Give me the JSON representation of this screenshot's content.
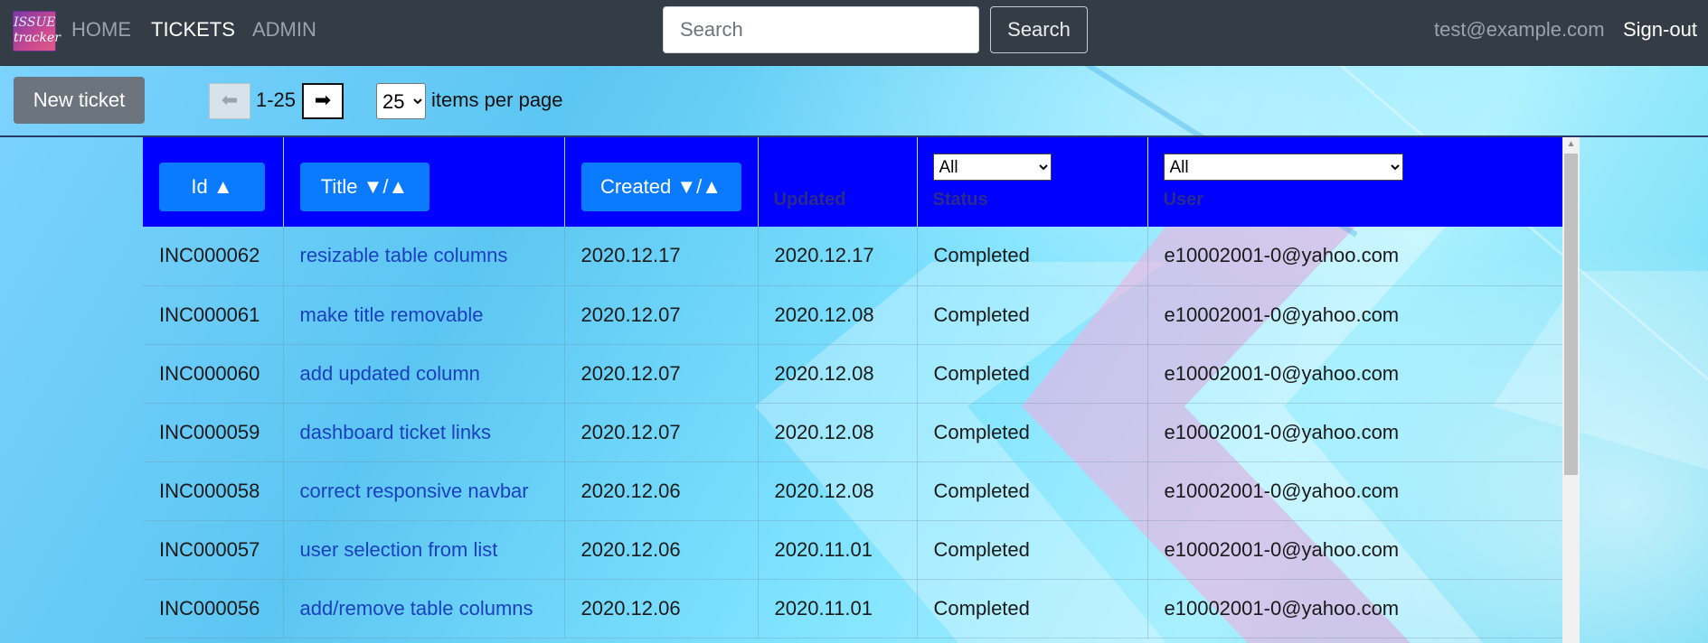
{
  "nav": {
    "logo_line1": "ISSUE",
    "logo_line2": "tracker",
    "links": [
      "HOME",
      "TICKETS",
      "ADMIN"
    ],
    "search_placeholder": "Search",
    "search_button": "Search",
    "user_email": "test@example.com",
    "signout": "Sign-out"
  },
  "toolbar": {
    "new_ticket": "New ticket",
    "prev_icon": "⬅",
    "range": "1-25",
    "next_icon": "➡",
    "per_page_value": "25",
    "per_page_label": "items per page"
  },
  "table": {
    "columns": {
      "id": "Id  ▲",
      "title": "Title ▼/▲",
      "created": "Created ▼/▲",
      "updated": "Updated",
      "status": "Status",
      "user": "User"
    },
    "status_filter": "All",
    "user_filter": "All",
    "rows": [
      [
        "INC000062",
        "resizable table columns",
        "2020.12.17",
        "2020.12.17",
        "Completed",
        "e10002001-0@yahoo.com"
      ],
      [
        "INC000061",
        "make title removable",
        "2020.12.07",
        "2020.12.08",
        "Completed",
        "e10002001-0@yahoo.com"
      ],
      [
        "INC000060",
        "add updated column",
        "2020.12.07",
        "2020.12.08",
        "Completed",
        "e10002001-0@yahoo.com"
      ],
      [
        "INC000059",
        "dashboard ticket links",
        "2020.12.07",
        "2020.12.08",
        "Completed",
        "e10002001-0@yahoo.com"
      ],
      [
        "INC000058",
        "correct responsive navbar",
        "2020.12.06",
        "2020.12.08",
        "Completed",
        "e10002001-0@yahoo.com"
      ],
      [
        "INC000057",
        "user selection from list",
        "2020.12.06",
        "2020.11.01",
        "Completed",
        "e10002001-0@yahoo.com"
      ],
      [
        "INC000056",
        "add/remove table columns",
        "2020.12.06",
        "2020.11.01",
        "Completed",
        "e10002001-0@yahoo.com"
      ]
    ]
  }
}
